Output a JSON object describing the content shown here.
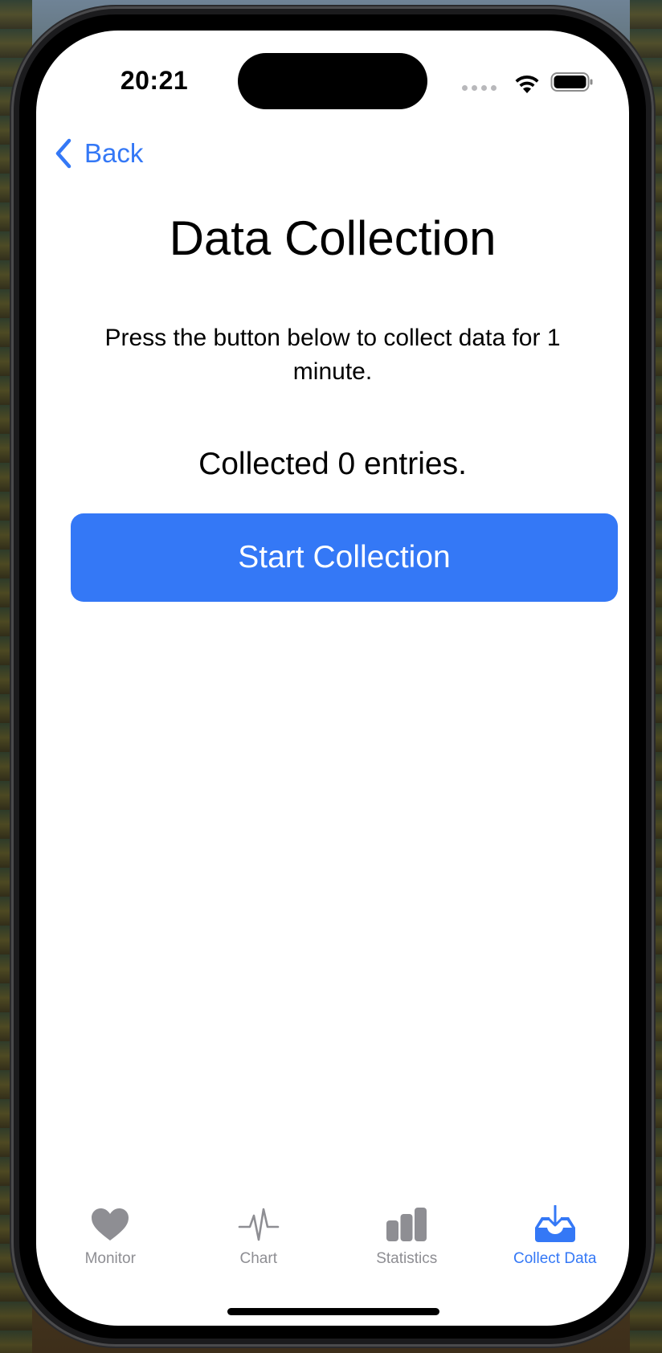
{
  "status_bar": {
    "time": "20:21",
    "wifi_icon": "wifi-icon",
    "battery_icon": "battery-icon"
  },
  "nav": {
    "back_label": "Back",
    "back_icon": "chevron-left-icon"
  },
  "main": {
    "title": "Data Collection",
    "instructions": "Press the button below to collect data for 1 minute.",
    "collected_text": "Collected 0 entries.",
    "start_button_label": "Start Collection"
  },
  "tab_bar": {
    "tabs": [
      {
        "label": "Monitor",
        "icon": "heart-icon",
        "active": false
      },
      {
        "label": "Chart",
        "icon": "waveform-icon",
        "active": false
      },
      {
        "label": "Statistics",
        "icon": "bar-chart-icon",
        "active": false
      },
      {
        "label": "Collect Data",
        "icon": "tray-download-icon",
        "active": true
      }
    ]
  },
  "colors": {
    "accent": "#3478f6",
    "inactive_tab": "#8e8e93",
    "background": "#ffffff"
  }
}
